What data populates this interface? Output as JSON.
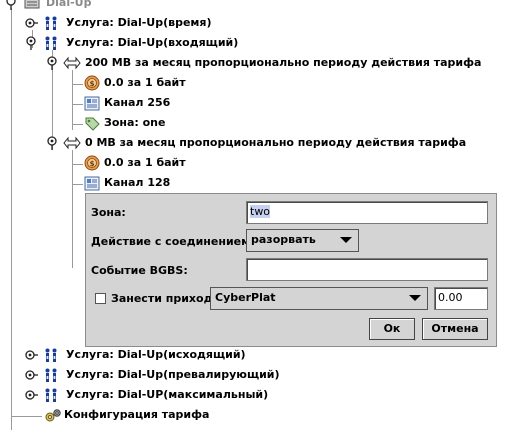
{
  "tree": {
    "root": {
      "label": "Dial-Up"
    },
    "nodes": [
      {
        "label": "Услуга: Dial-Up(время)"
      },
      {
        "label": "Услуга: Dial-Up(входящий)"
      },
      {
        "label": "200 MB за месяц пропорционально периоду действия тарифа"
      },
      {
        "label": "0.0 за 1 байт"
      },
      {
        "label": "Канал 256"
      },
      {
        "label": "Зона: one"
      },
      {
        "label": "0 MB за месяц пропорционально периоду действия тарифа"
      },
      {
        "label": "0.0 за 1 байт"
      },
      {
        "label": "Канал 128"
      },
      {
        "label": "Услуга: Dial-Up(исходящий)"
      },
      {
        "label": "Услуга: Dial-Up(превалирующий)"
      },
      {
        "label": "Услуга: Dial-UP(максимальный)"
      },
      {
        "label": "Конфигурация тарифа"
      }
    ]
  },
  "editor": {
    "zone_label": "Зона:",
    "zone_value": "two",
    "action_label": "Действие с соединением:",
    "action_value": "разорвать",
    "event_label": "Событие BGBS:",
    "event_value": "",
    "income_label": "Занести приход:",
    "income_checked": false,
    "income_source": "CyberPlat",
    "income_amount": "0.00",
    "ok_label": "Ок",
    "cancel_label": "Отмена"
  }
}
